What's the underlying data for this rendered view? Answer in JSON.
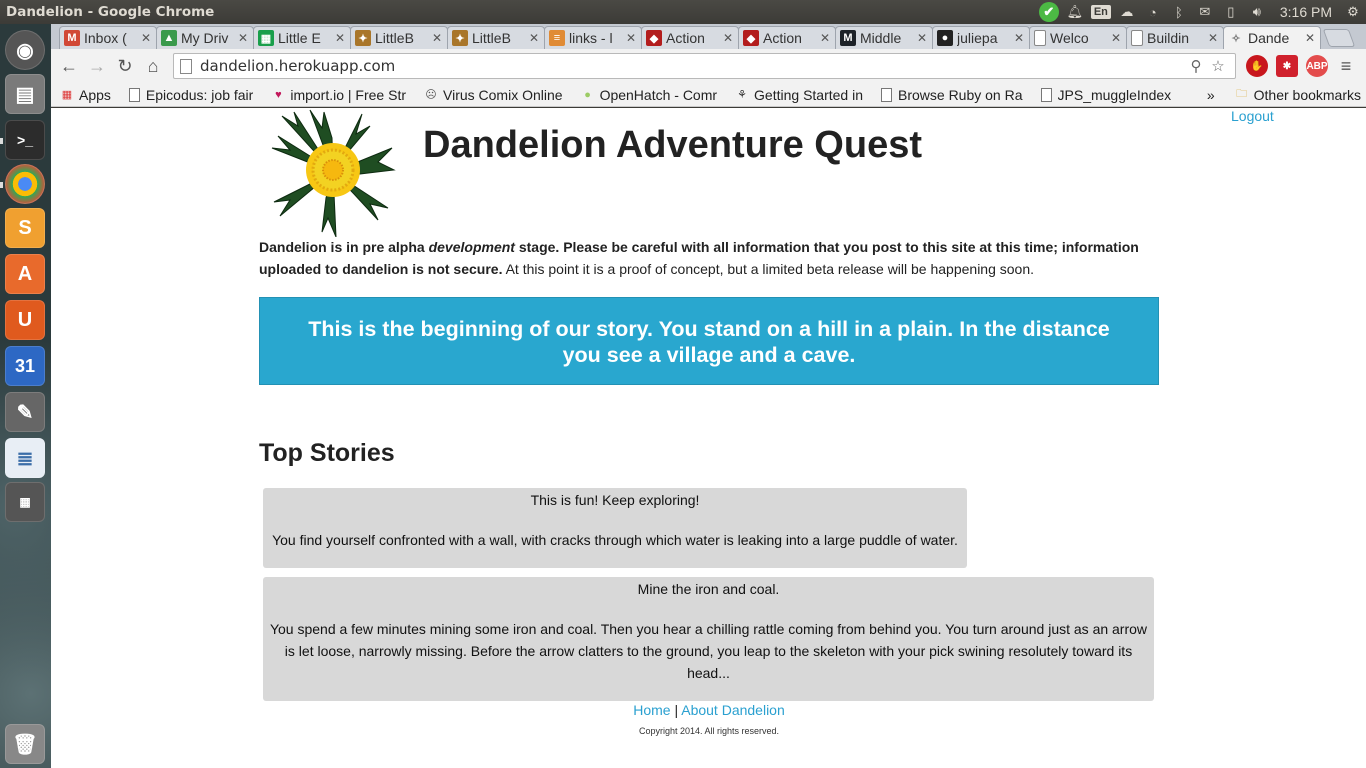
{
  "window": {
    "title": "Dandelion - Google Chrome"
  },
  "panel": {
    "clock": "3:16 PM",
    "lang": "En"
  },
  "tabs": [
    {
      "label": "Inbox (",
      "icon": "gmail-icon",
      "color": "#d14836",
      "glyph": "M",
      "active": false
    },
    {
      "label": "My Driv",
      "icon": "drive-icon",
      "color": "#3a9a4c",
      "glyph": "▲",
      "active": false
    },
    {
      "label": "Little E",
      "icon": "sheets-icon",
      "color": "#199f4b",
      "glyph": "▦",
      "active": false
    },
    {
      "label": "LittleB",
      "icon": "littlebird-icon",
      "color": "#a9762a",
      "glyph": "✦",
      "active": false
    },
    {
      "label": "LittleB",
      "icon": "littlebird-icon",
      "color": "#a9762a",
      "glyph": "✦",
      "active": false
    },
    {
      "label": "links - l",
      "icon": "stackoverflow-icon",
      "color": "#e08b35",
      "glyph": "≡",
      "active": false
    },
    {
      "label": "Action",
      "icon": "rails-icon",
      "color": "#b31d1d",
      "glyph": "◆",
      "active": false
    },
    {
      "label": "Action",
      "icon": "rails-icon",
      "color": "#b31d1d",
      "glyph": "◆",
      "active": false
    },
    {
      "label": "Middle",
      "icon": "middleman-icon",
      "color": "#1d2228",
      "glyph": "M",
      "active": false
    },
    {
      "label": "juliepa",
      "icon": "github-icon",
      "color": "#222222",
      "glyph": "●",
      "active": false
    },
    {
      "label": "Welco",
      "icon": "page-icon",
      "color": "#ffffff",
      "glyph": "",
      "active": false
    },
    {
      "label": "Buildin",
      "icon": "page-icon",
      "color": "#ffffff",
      "glyph": "",
      "active": false
    },
    {
      "label": "Dande",
      "icon": "dandelion-icon",
      "color": "#f2f2f2",
      "glyph": "✧",
      "active": true
    }
  ],
  "toolbar": {
    "url": "dandelion.herokuapp.com"
  },
  "bookmarks": [
    {
      "label": "Apps",
      "type": "apps"
    },
    {
      "label": "Epicodus: job fair",
      "type": "page"
    },
    {
      "label": "import.io | Free Str",
      "type": "importio"
    },
    {
      "label": "Virus Comix Online",
      "type": "virus"
    },
    {
      "label": "OpenHatch - Comr",
      "type": "openhatch"
    },
    {
      "label": "Getting Started in",
      "type": "getting"
    },
    {
      "label": "Browse Ruby on Ra",
      "type": "page"
    },
    {
      "label": "JPS_muggleIndex",
      "type": "page"
    }
  ],
  "bookmarks_more": "»",
  "bookmarks_other": "Other bookmarks",
  "page": {
    "logout": "Logout",
    "site_title": "Dandelion Adventure Quest",
    "notice_bold_1": "Dandelion is in pre alpha ",
    "notice_em": "development",
    "notice_bold_2": " stage. Please be careful with all information that you post to this site at this time; information uploaded to dandelion is not secure.",
    "notice_rest": " At this point it is a proof of concept, but a limited beta release will be happening soon.",
    "story_intro": "This is the beginning of our story. You stand on a hill in a plain. In the distance you see a village and a cave.",
    "top_stories_heading": "Top Stories",
    "stories": [
      {
        "title": "This is fun! Keep exploring!",
        "body": "You find yourself confronted with a wall, with cracks through which water is leaking into a large puddle of water."
      },
      {
        "title": "Mine the iron and coal.",
        "body": "You spend a few minutes mining some iron and coal. Then you hear a chilling rattle coming from behind you. You turn around just as an arrow is let loose, narrowly missing. Before the arrow clatters to the ground, you leap to the skeleton with your pick swining resolutely toward its head..."
      }
    ],
    "footer_home": "Home",
    "footer_sep": "|",
    "footer_about": "About Dandelion",
    "copyright": "Copyright 2014. All rights reserved."
  },
  "colors": {
    "accent": "#29a7cf",
    "link": "#2aa0d0",
    "card": "#d8d8d8"
  }
}
